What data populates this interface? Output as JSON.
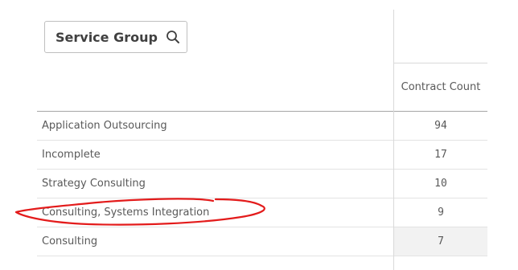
{
  "filter": {
    "label": "Service Group",
    "icon": "search-icon"
  },
  "column_header": "Contract Count",
  "rows": [
    {
      "name": "Application Outsourcing",
      "count": "94"
    },
    {
      "name": "Incomplete",
      "count": "17"
    },
    {
      "name": "Strategy Consulting",
      "count": "10"
    },
    {
      "name": "Consulting, Systems Integration",
      "count": "9"
    },
    {
      "name": "Consulting",
      "count": "7"
    }
  ],
  "colors": {
    "annotation": "#e31b1b",
    "border": "#d9d9d9",
    "text": "#595959"
  }
}
